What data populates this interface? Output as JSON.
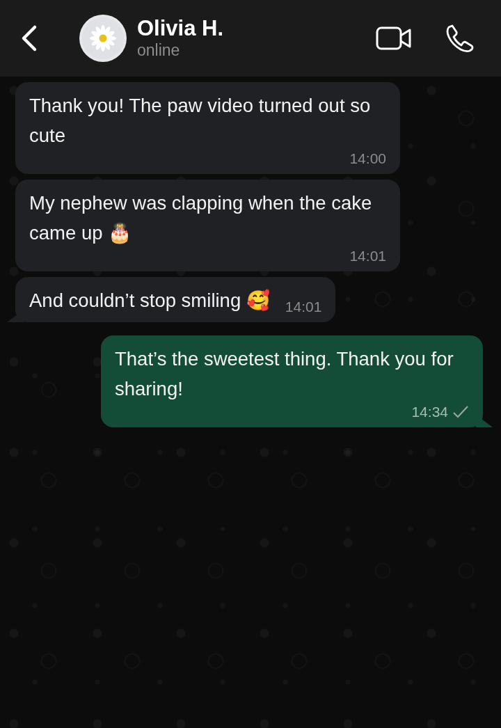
{
  "header": {
    "contact_name": "Olivia H.",
    "status": "online"
  },
  "messages": [
    {
      "kind": "incoming",
      "text": "Thank you! The paw video turned out so cute",
      "time": "14:00",
      "tail": false
    },
    {
      "kind": "incoming",
      "text": "My nephew was clapping when the cake came up 🎂",
      "time": "14:01",
      "tail": false
    },
    {
      "kind": "incoming",
      "text": "And couldn’t stop smiling 🥰",
      "time": "14:01",
      "tail": true
    },
    {
      "kind": "outgoing",
      "text": "That’s the sweetest thing. Thank you for sharing!",
      "time": "14:34",
      "read": false,
      "tail": true
    }
  ]
}
